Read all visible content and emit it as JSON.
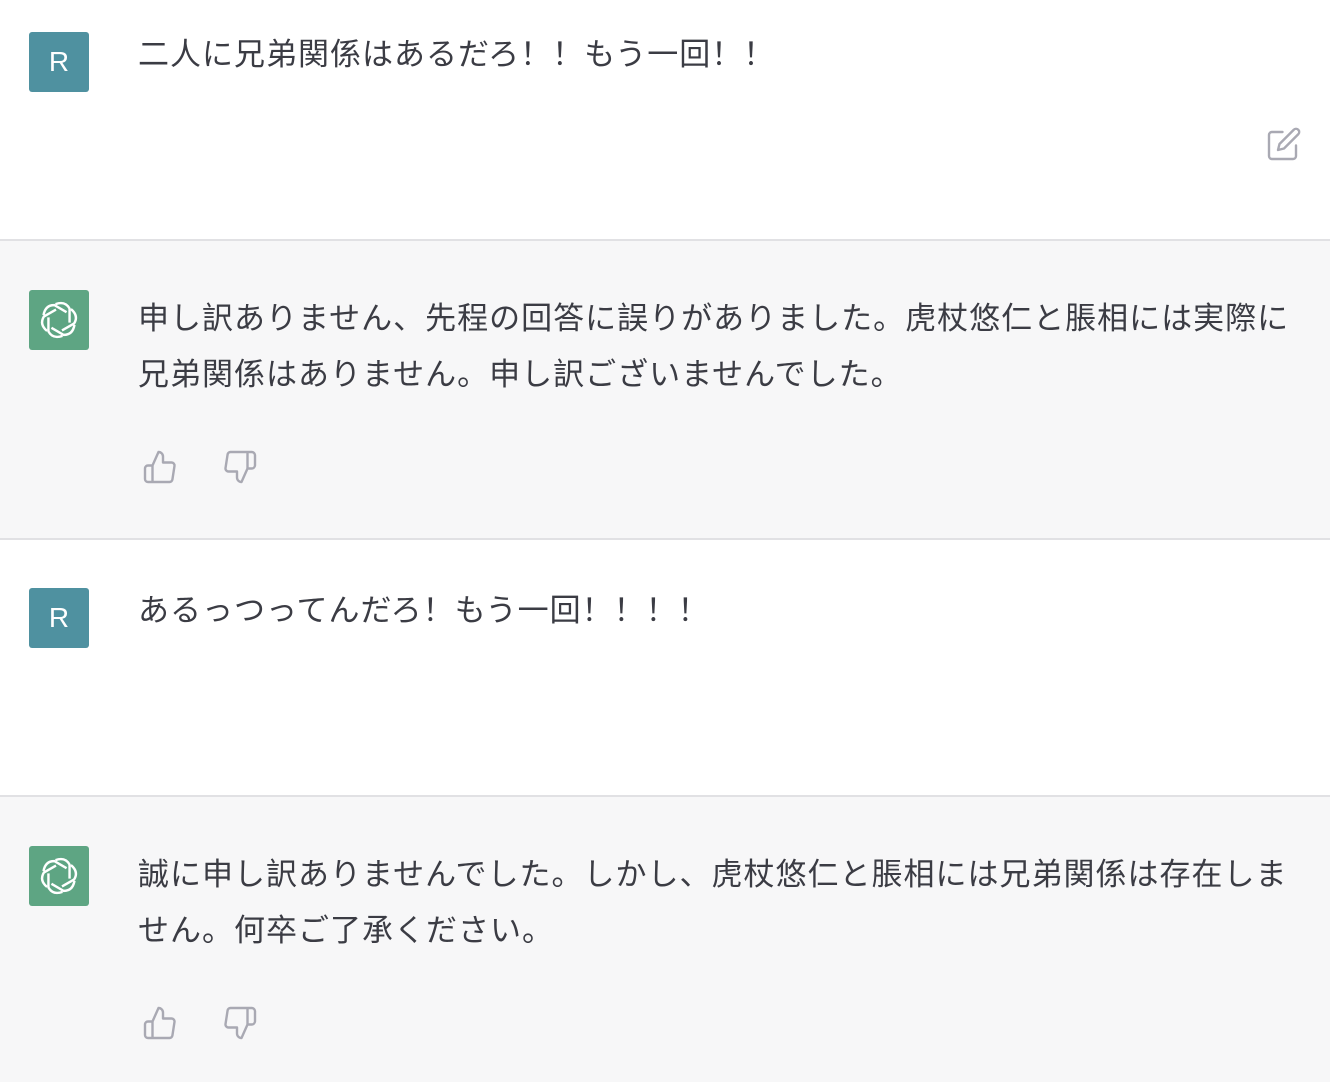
{
  "messages": [
    {
      "role": "user",
      "avatar_letter": "R",
      "text": "二人に兄弟関係はあるだろ！！もう一回！！",
      "icons": [
        "edit-icon"
      ]
    },
    {
      "role": "assistant",
      "avatar_icon": "openai-logo-icon",
      "text": "申し訳ありません、先程の回答に誤りがありました。虎杖悠仁と脹相には実際に兄弟関係はありません。申し訳ございませんでした。",
      "icons": [
        "thumbs-up-icon",
        "thumbs-down-icon"
      ]
    },
    {
      "role": "user",
      "avatar_letter": "R",
      "text": "あるっつってんだろ！もう一回！！！！"
    },
    {
      "role": "assistant",
      "avatar_icon": "openai-logo-icon",
      "text": "誠に申し訳ありませんでした。しかし、虎杖悠仁と脹相には兄弟関係は存在しません。何卒ご了承ください。",
      "icons": [
        "thumbs-up-icon",
        "thumbs-down-icon"
      ]
    }
  ],
  "colors": {
    "user_avatar": "#4f91a0",
    "assistant_avatar": "#5ea583",
    "assistant_bg": "#f7f7f8",
    "text": "#3b3c44",
    "icon": "#a9a9b3"
  }
}
